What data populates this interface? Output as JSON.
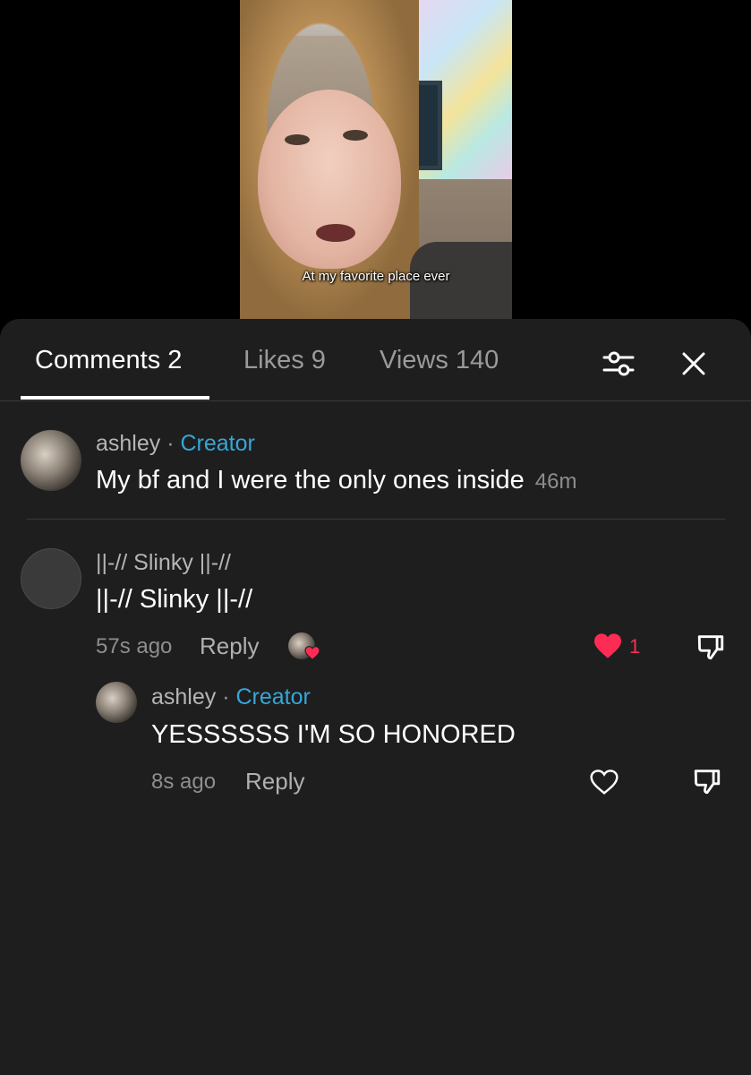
{
  "video": {
    "caption": "At my favorite place ever"
  },
  "tabs": [
    {
      "label": "Comments 2",
      "active": true
    },
    {
      "label": "Likes 9",
      "active": false
    },
    {
      "label": "Views 140",
      "active": false
    }
  ],
  "icons": {
    "filter": "sliders-icon",
    "close": "close-icon",
    "like": "heart-icon",
    "dislike": "thumbs-down-icon"
  },
  "colors": {
    "creator": "#36a6d8",
    "like": "#fe2c55",
    "sheet_bg": "#1e1e1e"
  },
  "comments": [
    {
      "username": "ashley",
      "separator": "·",
      "badge": "Creator",
      "text": "My bf and I were the only ones inside",
      "time": "46m"
    },
    {
      "username": "||-// Slinky ||-//",
      "text": "||-// Slinky ||-//",
      "time": "57s ago",
      "reply_label": "Reply",
      "liked": true,
      "like_count": "1",
      "replies": [
        {
          "username": "ashley",
          "separator": "·",
          "badge": "Creator",
          "text": "YESSSSSS I'M SO HONORED",
          "time": "8s ago",
          "reply_label": "Reply"
        }
      ]
    }
  ]
}
